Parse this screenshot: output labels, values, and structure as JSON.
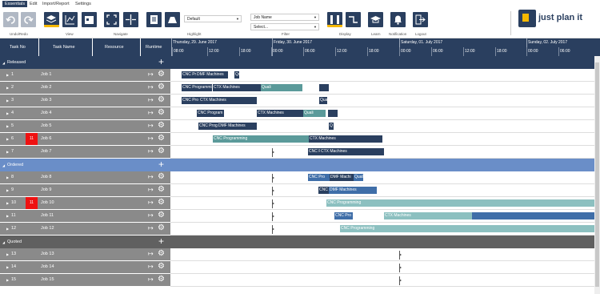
{
  "menu": {
    "essentials": "Essentials",
    "edit": "Edit",
    "import_report": "Import/Report",
    "settings": "Settings"
  },
  "ribbon": {
    "groups": {
      "undo_redo": "Undo/Redo",
      "view": "View",
      "navigate": "Navigate",
      "highlight": "Highlight",
      "filter": "Filter",
      "display": "Display",
      "learn": "Learn",
      "notification": "Notification",
      "logout": "Logout"
    },
    "highlight_value": "Default",
    "filter_field": "Job Name",
    "filter_value": "Select..."
  },
  "logo": {
    "text": "just plan it"
  },
  "columns": {
    "task_no": "Task No",
    "task_name": "Task Name",
    "resource": "Resource",
    "runtime": "Runtime"
  },
  "timeline": {
    "days": [
      "Thursday, 29. June 2017",
      "Friday, 30. June 2017",
      "Saturday, 01. July 2017",
      "Sunday, 02. July 2017"
    ],
    "hours": [
      "08:00",
      "12:00",
      "18:00",
      "00:00",
      "06:00",
      "12:00",
      "18:00",
      "00:00",
      "06:00",
      "12:00",
      "18:00",
      "00:00",
      "06:00"
    ]
  },
  "groups": [
    {
      "label": "Released",
      "color": "#2a3f5f",
      "text": "#ffffff"
    },
    {
      "label": "Ordered",
      "color": "#6a8ec8",
      "text": "#ffffff"
    },
    {
      "label": "Quoted",
      "color": "#606060",
      "text": "#ffffff"
    }
  ],
  "rows": [
    {
      "no": "1",
      "name": "Job 1",
      "flag": "",
      "bars": [
        "CNC Pro",
        "DMF Machines",
        "Qu"
      ]
    },
    {
      "no": "2",
      "name": "Job 2",
      "flag": "",
      "bars": [
        "CNC Programmi",
        "CTX Machines",
        "Quali"
      ]
    },
    {
      "no": "3",
      "name": "Job 3",
      "flag": "",
      "bars": [
        "CNC Pro",
        "CTX Machines",
        "Qua"
      ]
    },
    {
      "no": "4",
      "name": "Job 4",
      "flag": "",
      "bars": [
        "CNC Program",
        "CTX Machines",
        "Quali"
      ]
    },
    {
      "no": "5",
      "name": "Job 5",
      "flag": "",
      "bars": [
        "CNC Progr",
        "DMF Machines",
        "Q"
      ]
    },
    {
      "no": "6",
      "name": "Job 6",
      "flag": "11",
      "bars": [
        "CNC Programming",
        "CTX Machines"
      ]
    },
    {
      "no": "7",
      "name": "Job 7",
      "flag": "",
      "bars": [
        "CNC Pro",
        "CTX Machines"
      ]
    },
    {
      "no": "8",
      "name": "Job 8",
      "flag": "",
      "bars": [
        "CNC Pro",
        "DMF Machi",
        "Quali"
      ]
    },
    {
      "no": "9",
      "name": "Job 9",
      "flag": "",
      "bars": [
        "CNC Progr",
        "DMF Machines"
      ]
    },
    {
      "no": "10",
      "name": "Job 10",
      "flag": "11",
      "bars": [
        "CNC Programming"
      ]
    },
    {
      "no": "11",
      "name": "Job 11",
      "flag": "",
      "bars": [
        "CNC Pro",
        "CTX Machines"
      ]
    },
    {
      "no": "12",
      "name": "Job 12",
      "flag": "",
      "bars": [
        "CNC Programming"
      ]
    },
    {
      "no": "13",
      "name": "Job 13",
      "flag": "",
      "bars": []
    },
    {
      "no": "14",
      "name": "Job 14",
      "flag": "",
      "bars": []
    },
    {
      "no": "15",
      "name": "Job 15",
      "flag": "",
      "bars": []
    }
  ]
}
